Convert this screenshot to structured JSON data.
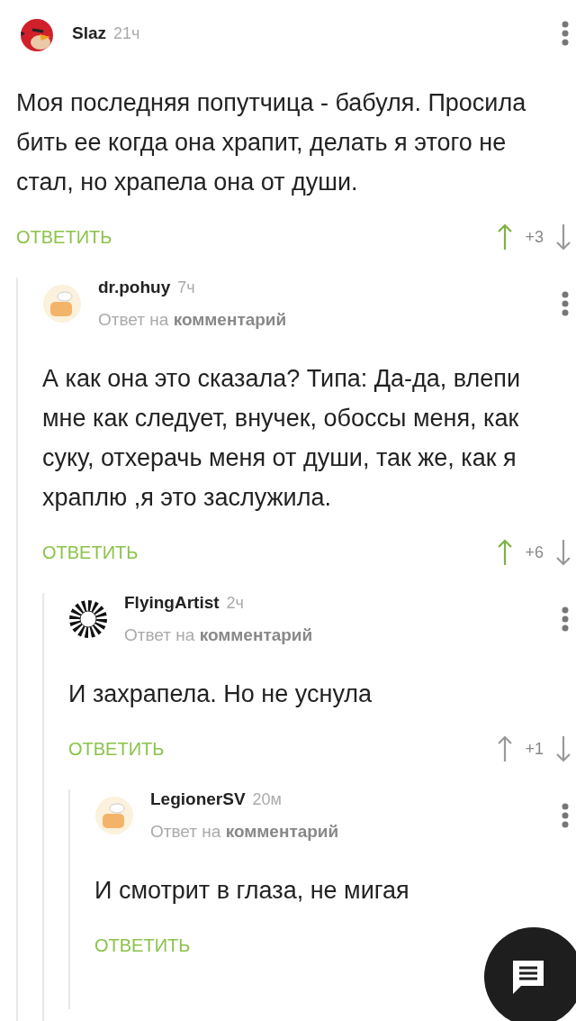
{
  "comments": [
    {
      "author": "Slaz",
      "time": "21ч",
      "avatar": {
        "kind": "bird"
      },
      "body": "Моя последняя попутчица - бабуля. Просила бить ее когда она храпит, делать я этого не стал, но храпела она от души.",
      "reply": "ОТВЕТИТЬ",
      "votes": {
        "score": "+3",
        "upvoted": true
      },
      "children": [
        {
          "author": "dr.pohuy",
          "time": "7ч",
          "avatar": {
            "kind": "toast"
          },
          "reply_to": "Ответ на **комментарий**",
          "body": "А как она это сказала? Типа: Да-да, влепи мне как следует, внучек, обоссы меня, как суку, отхерачь меня от души, так же, как я храплю ,я это заслужила.",
          "reply": "ОТВЕТИТЬ",
          "votes": {
            "score": "+6",
            "upvoted": true
          },
          "children": [
            {
              "author": "FlyingArtist",
              "time": "2ч",
              "avatar": {
                "kind": "rays"
              },
              "reply_to": "Ответ на **комментарий**",
              "body": "И захрапела. Но не уснула",
              "reply": "ОТВЕТИТЬ",
              "votes": {
                "score": "+1",
                "upvoted": false
              },
              "children": [
                {
                  "author": "LegionerSV",
                  "time": "20м",
                  "avatar": {
                    "kind": "toast"
                  },
                  "reply_to": "Ответ на **комментарий**",
                  "body": "И смотрит в глаза, не мигая",
                  "reply": "ОТВЕТИТЬ"
                }
              ]
            }
          ]
        }
      ]
    }
  ]
}
